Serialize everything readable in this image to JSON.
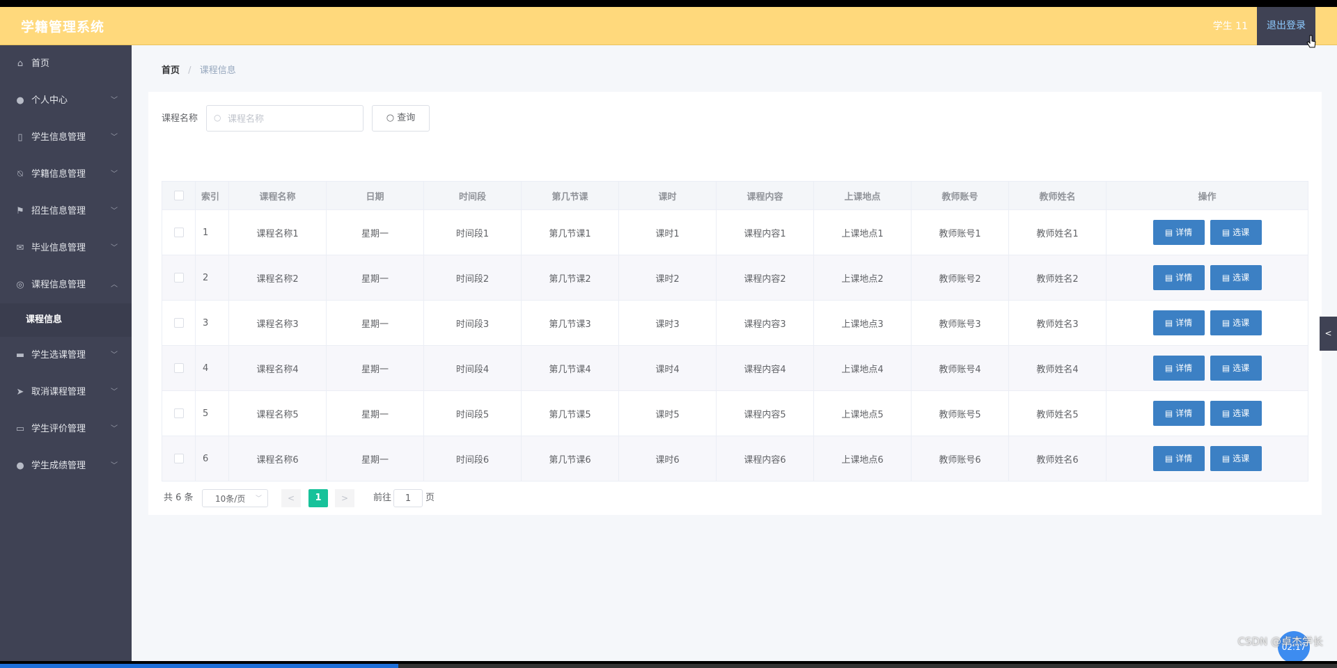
{
  "header": {
    "title": "学籍管理系统",
    "user": "学生 11",
    "logout": "退出登录"
  },
  "sidebar": {
    "items": [
      {
        "label": "首页",
        "icon": "home-icon"
      },
      {
        "label": "个人中心",
        "icon": "user-icon"
      },
      {
        "label": "学生信息管理",
        "icon": "mic-icon"
      },
      {
        "label": "学籍信息管理",
        "icon": "bell-off-icon"
      },
      {
        "label": "招生信息管理",
        "icon": "flag-icon"
      },
      {
        "label": "毕业信息管理",
        "icon": "message-icon"
      },
      {
        "label": "课程信息管理",
        "icon": "target-icon"
      },
      {
        "label": "学生选课管理",
        "icon": "suitcase-icon"
      },
      {
        "label": "取消课程管理",
        "icon": "send-icon"
      },
      {
        "label": "学生评价管理",
        "icon": "postcard-icon"
      },
      {
        "label": "学生成绩管理",
        "icon": "user-icon"
      }
    ],
    "sub_item": "课程信息"
  },
  "breadcrumb": {
    "home": "首页",
    "sep": "/",
    "current": "课程信息"
  },
  "search": {
    "label": "课程名称",
    "placeholder": "课程名称",
    "button": "查询"
  },
  "table": {
    "headers": [
      "索引",
      "课程名称",
      "日期",
      "时间段",
      "第几节课",
      "课时",
      "课程内容",
      "上课地点",
      "教师账号",
      "教师姓名",
      "操作"
    ],
    "rows": [
      [
        "1",
        "课程名称1",
        "星期一",
        "时间段1",
        "第几节课1",
        "课时1",
        "课程内容1",
        "上课地点1",
        "教师账号1",
        "教师姓名1"
      ],
      [
        "2",
        "课程名称2",
        "星期一",
        "时间段2",
        "第几节课2",
        "课时2",
        "课程内容2",
        "上课地点2",
        "教师账号2",
        "教师姓名2"
      ],
      [
        "3",
        "课程名称3",
        "星期一",
        "时间段3",
        "第几节课3",
        "课时3",
        "课程内容3",
        "上课地点3",
        "教师账号3",
        "教师姓名3"
      ],
      [
        "4",
        "课程名称4",
        "星期一",
        "时间段4",
        "第几节课4",
        "课时4",
        "课程内容4",
        "上课地点4",
        "教师账号4",
        "教师姓名4"
      ],
      [
        "5",
        "课程名称5",
        "星期一",
        "时间段5",
        "第几节课5",
        "课时5",
        "课程内容5",
        "上课地点5",
        "教师账号5",
        "教师姓名5"
      ],
      [
        "6",
        "课程名称6",
        "星期一",
        "时间段6",
        "第几节课6",
        "课时6",
        "课程内容6",
        "上课地点6",
        "教师账号6",
        "教师姓名6"
      ]
    ],
    "detail_btn": "详情",
    "select_btn": "选课"
  },
  "pagination": {
    "total": "共 6 条",
    "page_size": "10条/页",
    "current": "1",
    "goto_label": "前往",
    "goto_value": "1",
    "unit": "页"
  },
  "overlay": {
    "timer": "02:17",
    "watermark": "CSDN @卓杰学长",
    "playback_progress": 0.298
  },
  "colors": {
    "header": "#ffd97c",
    "sidebar": "#3f4254",
    "button": "#3c80c4",
    "page_active": "#17c29a"
  }
}
